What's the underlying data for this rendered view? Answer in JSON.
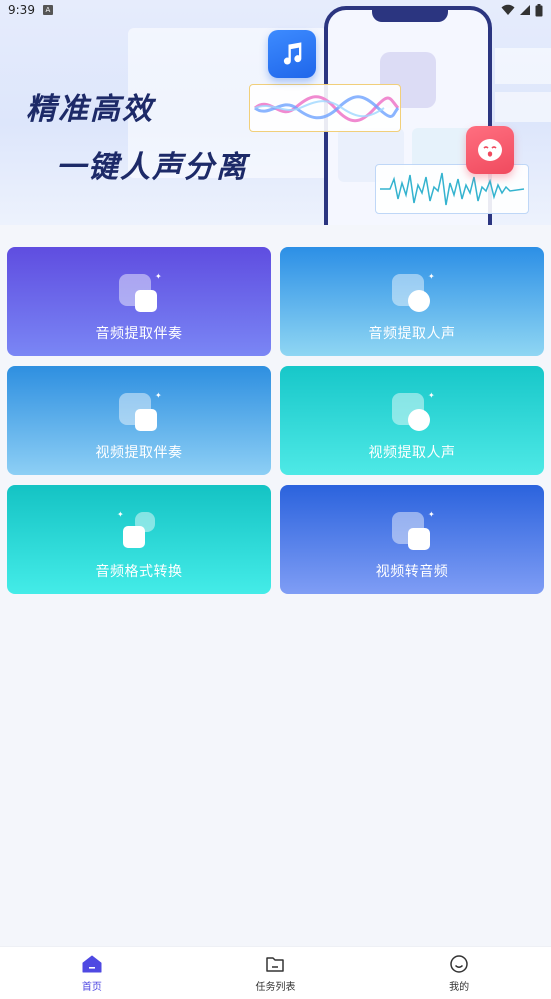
{
  "status_bar": {
    "time": "9:39",
    "notification_glyph": "A",
    "icons": [
      "wifi-icon",
      "signal-icon",
      "battery-icon"
    ]
  },
  "banner": {
    "line1": "精准高效",
    "line2": "一键人声分离",
    "badges": [
      "music-note-icon",
      "face-icon"
    ]
  },
  "features": [
    {
      "label": "音频提取伴奏",
      "icon": "audio-music-icon",
      "gradient": [
        "#5f4de0",
        "#7a86f5"
      ]
    },
    {
      "label": "音频提取人声",
      "icon": "audio-voice-icon",
      "gradient": [
        "#2c8fe6",
        "#8fd6f3"
      ]
    },
    {
      "label": "视频提取伴奏",
      "icon": "video-music-icon",
      "gradient": [
        "#2e8fe0",
        "#8dcff5"
      ]
    },
    {
      "label": "视频提取人声",
      "icon": "video-voice-icon",
      "gradient": [
        "#17c7c9",
        "#4ee9e6"
      ]
    },
    {
      "label": "音频格式转换",
      "icon": "audio-convert-icon",
      "gradient": [
        "#14c3c4",
        "#44ece8"
      ]
    },
    {
      "label": "视频转音频",
      "icon": "video-to-audio-icon",
      "gradient": [
        "#2b63dd",
        "#7f9df5"
      ]
    }
  ],
  "tabbar": {
    "tabs": [
      {
        "label": "首页",
        "icon": "home-icon",
        "active": true
      },
      {
        "label": "任务列表",
        "icon": "folder-icon",
        "active": false
      },
      {
        "label": "我的",
        "icon": "smiley-icon",
        "active": false
      }
    ],
    "active_color": "#4f49e2"
  }
}
